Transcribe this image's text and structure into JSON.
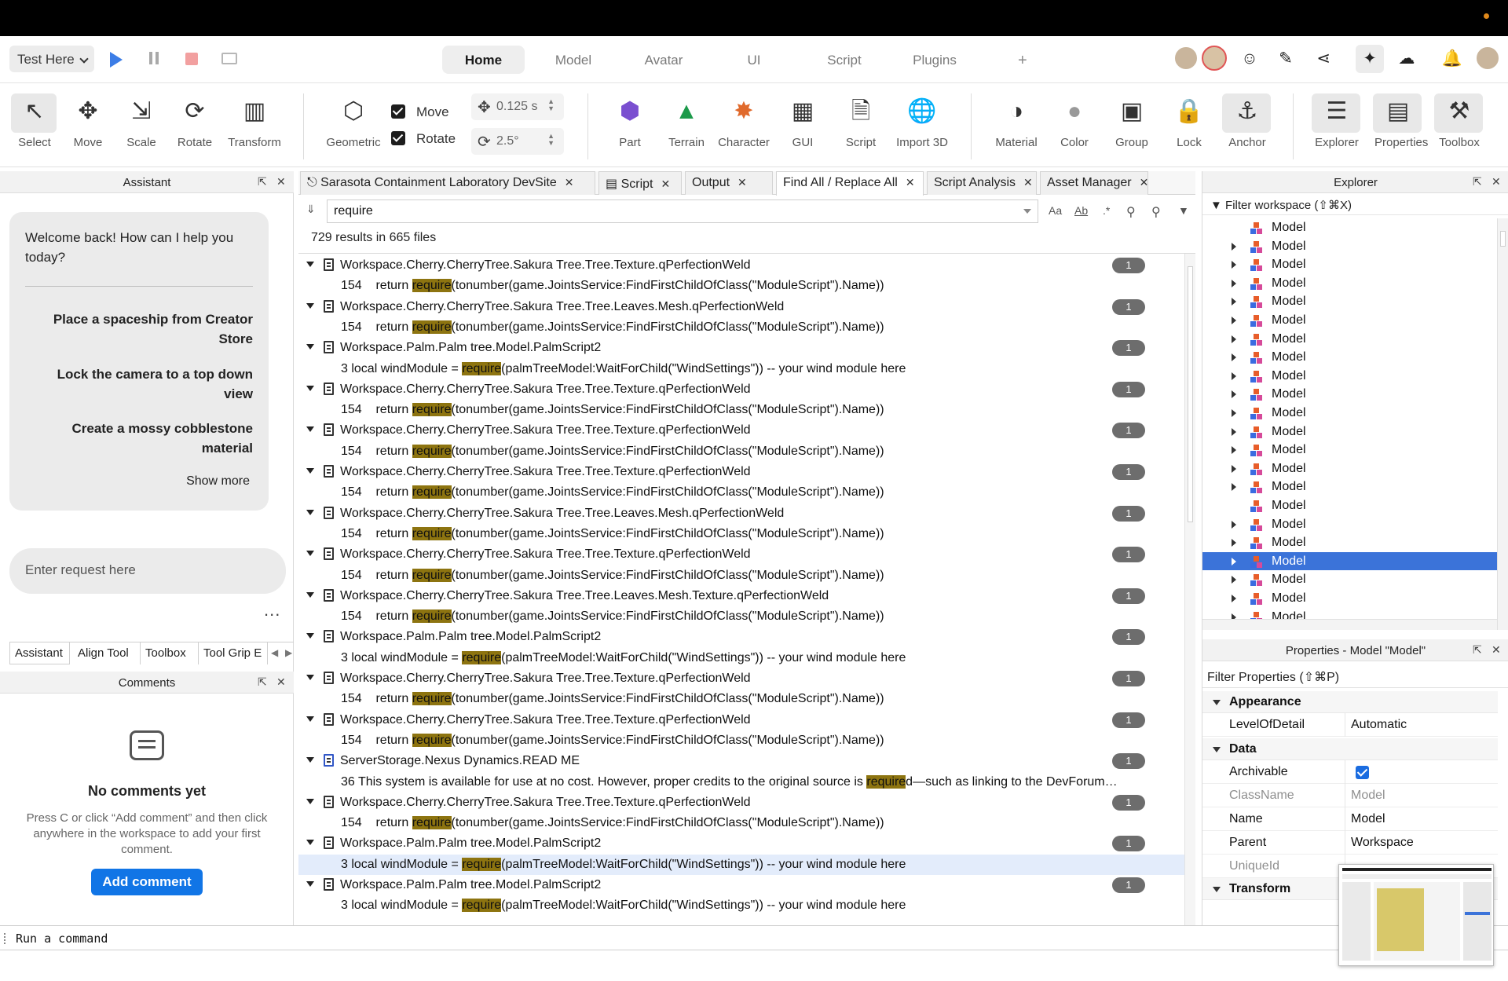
{
  "colors": {
    "accent": "#1175e6",
    "highlight": "#8d7410",
    "selection": "#3b73d9",
    "stop": "#f2a0a0"
  },
  "topbar": {
    "test_label": "Test Here",
    "tabs": [
      "Home",
      "Model",
      "Avatar",
      "UI",
      "Script",
      "Plugins"
    ],
    "active_tab": "Home",
    "add_tab": "+",
    "right_icons": [
      "avatar-icon",
      "collaborator-icon",
      "add-friend-icon",
      "chat-icon",
      "share-icon",
      "ai-assistant-icon",
      "cloud-icon",
      "bell-icon",
      "profile-icon"
    ]
  },
  "toolbar": {
    "select": "Select",
    "move": "Move",
    "scale": "Scale",
    "rotate": "Rotate",
    "transform": "Transform",
    "geometric": "Geometric",
    "move_toggle": "Move",
    "rotate_toggle": "Rotate",
    "move_increment": "0.125 s",
    "rotate_increment": "2.5°",
    "part": "Part",
    "terrain": "Terrain",
    "character": "Character",
    "gui": "GUI",
    "script": "Script",
    "import3d": "Import 3D",
    "material": "Material",
    "color": "Color",
    "group": "Group",
    "lock": "Lock",
    "anchor": "Anchor",
    "explorer": "Explorer",
    "properties": "Properties",
    "toolbox": "Toolbox"
  },
  "assistant": {
    "title": "Assistant",
    "welcome": "Welcome back! How can I help you today?",
    "suggestions": [
      "Place a spaceship from Creator Store",
      "Lock the camera to a top down view",
      "Create a mossy cobblestone material"
    ],
    "show_more": "Show more",
    "input_placeholder": "Enter request here",
    "more": "...",
    "tabs": [
      "Assistant",
      "Align Tool",
      "Toolbox",
      "Tool Grip E"
    ]
  },
  "comments": {
    "title": "Comments",
    "empty_title": "No comments yet",
    "empty_desc": "Press C or click “Add comment” and then click anywhere in the workspace to add your first comment.",
    "add_button": "Add comment"
  },
  "doc_tabs": [
    "Sarasota Containment Laboratory DevSite",
    "Script",
    "Output",
    "Find All / Replace All",
    "Script Analysis",
    "Asset Manager"
  ],
  "find": {
    "query": "require",
    "options": [
      "Aa",
      "Ab",
      ".*"
    ],
    "result_count": "729 results in 665 files"
  },
  "results": [
    {
      "path": "Workspace.Cherry.CherryTree.Sakura Tree.Tree.Texture.qPerfectionWeld",
      "count": "1",
      "pre": "154    return ",
      "match": "require",
      "post": "(tonumber(game.JointsService:FindFirstChildOfClass(\"ModuleScript\").Name))"
    },
    {
      "path": "Workspace.Cherry.CherryTree.Sakura Tree.Tree.Leaves.Mesh.qPerfectionWeld",
      "count": "1",
      "pre": "154    return ",
      "match": "require",
      "post": "(tonumber(game.JointsService:FindFirstChildOfClass(\"ModuleScript\").Name))"
    },
    {
      "path": "Workspace.Palm.Palm tree.Model.PalmScript2",
      "count": "1",
      "pre": "3 local windModule = ",
      "match": "require",
      "post": "(palmTreeModel:WaitForChild(\"WindSettings\")) -- your wind module here"
    },
    {
      "path": "Workspace.Cherry.CherryTree.Sakura Tree.Tree.Texture.qPerfectionWeld",
      "count": "1",
      "pre": "154    return ",
      "match": "require",
      "post": "(tonumber(game.JointsService:FindFirstChildOfClass(\"ModuleScript\").Name))"
    },
    {
      "path": "Workspace.Cherry.CherryTree.Sakura Tree.Tree.Texture.qPerfectionWeld",
      "count": "1",
      "pre": "154    return ",
      "match": "require",
      "post": "(tonumber(game.JointsService:FindFirstChildOfClass(\"ModuleScript\").Name))"
    },
    {
      "path": "Workspace.Cherry.CherryTree.Sakura Tree.Tree.Texture.qPerfectionWeld",
      "count": "1",
      "pre": "154    return ",
      "match": "require",
      "post": "(tonumber(game.JointsService:FindFirstChildOfClass(\"ModuleScript\").Name))"
    },
    {
      "path": "Workspace.Cherry.CherryTree.Sakura Tree.Tree.Leaves.Mesh.qPerfectionWeld",
      "count": "1",
      "pre": "154    return ",
      "match": "require",
      "post": "(tonumber(game.JointsService:FindFirstChildOfClass(\"ModuleScript\").Name))"
    },
    {
      "path": "Workspace.Cherry.CherryTree.Sakura Tree.Tree.Texture.qPerfectionWeld",
      "count": "1",
      "pre": "154    return ",
      "match": "require",
      "post": "(tonumber(game.JointsService:FindFirstChildOfClass(\"ModuleScript\").Name))"
    },
    {
      "path": "Workspace.Cherry.CherryTree.Sakura Tree.Tree.Leaves.Mesh.Texture.qPerfectionWeld",
      "count": "1",
      "pre": "154    return ",
      "match": "require",
      "post": "(tonumber(game.JointsService:FindFirstChildOfClass(\"ModuleScript\").Name))"
    },
    {
      "path": "Workspace.Palm.Palm tree.Model.PalmScript2",
      "count": "1",
      "pre": "3 local windModule = ",
      "match": "require",
      "post": "(palmTreeModel:WaitForChild(\"WindSettings\")) -- your wind module here"
    },
    {
      "path": "Workspace.Cherry.CherryTree.Sakura Tree.Tree.Texture.qPerfectionWeld",
      "count": "1",
      "pre": "154    return ",
      "match": "require",
      "post": "(tonumber(game.JointsService:FindFirstChildOfClass(\"ModuleScript\").Name))"
    },
    {
      "path": "Workspace.Cherry.CherryTree.Sakura Tree.Tree.Texture.qPerfectionWeld",
      "count": "1",
      "pre": "154    return ",
      "match": "require",
      "post": "(tonumber(game.JointsService:FindFirstChildOfClass(\"ModuleScript\").Name))"
    },
    {
      "path": "ServerStorage.Nexus Dynamics.READ ME",
      "count": "1",
      "readme": true,
      "pre": "36 This system is available for use at no cost. However, proper credits to the original source is ",
      "match": "require",
      "post": "d—such as linking to the DevForum…"
    },
    {
      "path": "Workspace.Cherry.CherryTree.Sakura Tree.Tree.Texture.qPerfectionWeld",
      "count": "1",
      "pre": "154    return ",
      "match": "require",
      "post": "(tonumber(game.JointsService:FindFirstChildOfClass(\"ModuleScript\").Name))"
    },
    {
      "path": "Workspace.Palm.Palm tree.Model.PalmScript2",
      "count": "1",
      "selected": true,
      "pre": "3 local windModule = ",
      "match": "require",
      "post": "(palmTreeModel:WaitForChild(\"WindSettings\")) -- your wind module here"
    },
    {
      "path": "Workspace.Palm.Palm tree.Model.PalmScript2",
      "count": "1",
      "pre": "3 local windModule = ",
      "match": "require",
      "post": "(palmTreeModel:WaitForChild(\"WindSettings\")) -- your wind module here"
    }
  ],
  "explorer": {
    "title": "Explorer",
    "filter": "Filter workspace (⇧⌘X)",
    "items": [
      {
        "label": "Model",
        "arrow": false
      },
      {
        "label": "Model",
        "arrow": true
      },
      {
        "label": "Model",
        "arrow": true
      },
      {
        "label": "Model",
        "arrow": true
      },
      {
        "label": "Model",
        "arrow": true
      },
      {
        "label": "Model",
        "arrow": true
      },
      {
        "label": "Model",
        "arrow": true
      },
      {
        "label": "Model",
        "arrow": true
      },
      {
        "label": "Model",
        "arrow": true
      },
      {
        "label": "Model",
        "arrow": true
      },
      {
        "label": "Model",
        "arrow": true
      },
      {
        "label": "Model",
        "arrow": true
      },
      {
        "label": "Model",
        "arrow": true
      },
      {
        "label": "Model",
        "arrow": true
      },
      {
        "label": "Model",
        "arrow": true
      },
      {
        "label": "Model",
        "arrow": false
      },
      {
        "label": "Model",
        "arrow": true
      },
      {
        "label": "Model",
        "arrow": true
      },
      {
        "label": "Model",
        "arrow": true,
        "selected": true
      },
      {
        "label": "Model",
        "arrow": true
      },
      {
        "label": "Model",
        "arrow": true
      },
      {
        "label": "Model",
        "arrow": true
      }
    ]
  },
  "properties": {
    "title": "Properties - Model \"Model\"",
    "filter": "Filter Properties (⇧⌘P)",
    "sections": {
      "appearance": "Appearance",
      "data": "Data",
      "transform": "Transform"
    },
    "rows": {
      "lod": {
        "key": "LevelOfDetail",
        "value": "Automatic"
      },
      "archivable": {
        "key": "Archivable",
        "value": true
      },
      "classname": {
        "key": "ClassName",
        "value": "Model"
      },
      "name": {
        "key": "Name",
        "value": "Model"
      },
      "parent": {
        "key": "Parent",
        "value": "Workspace"
      },
      "uniqueid": {
        "key": "UniqueId",
        "value": ""
      }
    }
  },
  "command_bar": {
    "placeholder": "Run a command"
  }
}
